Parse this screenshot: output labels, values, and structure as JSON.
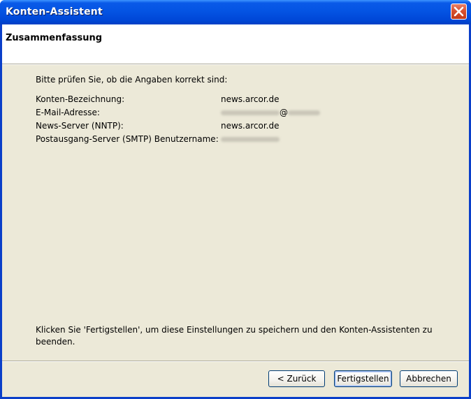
{
  "window": {
    "title": "Konten-Assistent"
  },
  "header": {
    "title": "Zusammenfassung"
  },
  "content": {
    "intro": "Bitte prüfen Sie, ob die Angaben korrekt sind:",
    "rows": [
      {
        "label": "Konten-Bezeichnung:",
        "value": "news.arcor.de"
      },
      {
        "label": "E-Mail-Adresse:",
        "value": "@"
      },
      {
        "label": "News-Server (NNTP):",
        "value": "news.arcor.de"
      },
      {
        "label": "Postausgang-Server (SMTP) Benutzername:",
        "value": ""
      }
    ],
    "footer_line1": "Klicken Sie 'Fertigstellen', um diese Einstellungen zu speichern und den Konten-Assistenten zu",
    "footer_line2": "beenden."
  },
  "buttons": {
    "back": "< Zurück",
    "finish": "Fertigstellen",
    "cancel": "Abbrechen"
  },
  "icons": {
    "close": "close-icon"
  }
}
